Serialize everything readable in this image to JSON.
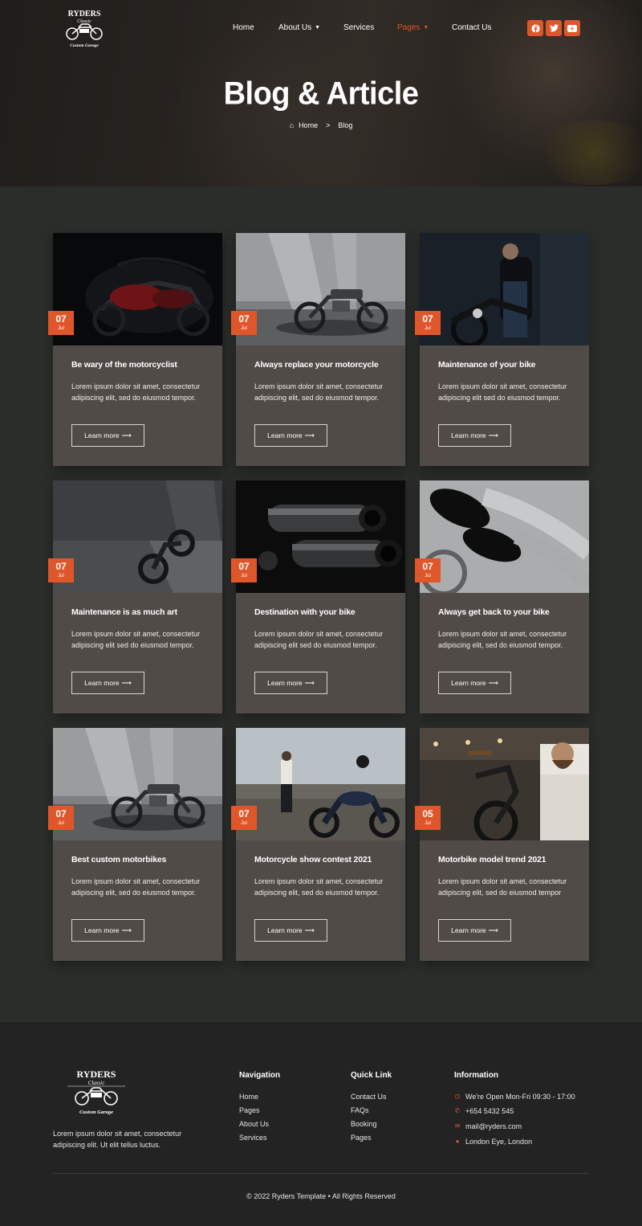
{
  "header": {
    "logo": {
      "brand": "RYDERS",
      "sub": "Classic",
      "tag": "Custom Garage"
    },
    "nav": [
      {
        "label": "Home",
        "caret": false,
        "active": false
      },
      {
        "label": "About Us",
        "caret": true,
        "active": false
      },
      {
        "label": "Services",
        "caret": false,
        "active": false
      },
      {
        "label": "Pages",
        "caret": true,
        "active": true
      },
      {
        "label": "Contact Us",
        "caret": false,
        "active": false
      }
    ],
    "social": [
      "facebook-icon",
      "twitter-icon",
      "youtube-icon"
    ]
  },
  "hero": {
    "title": "Blog & Article",
    "breadcrumb_home": "Home",
    "breadcrumb_sep": ">",
    "breadcrumb_current": "Blog"
  },
  "posts": [
    {
      "day": "07",
      "month": "Jul",
      "title": "Be wary of the motorcyclist",
      "text": "Lorem ipsum dolor sit amet, consectetur adipiscing elit, sed do eiusmod tempor.",
      "button": "Learn more",
      "scene": "red-bike-dark"
    },
    {
      "day": "07",
      "month": "Jul",
      "title": "Always replace your motorcycle",
      "text": "Lorem ipsum dolor sit amet, consectetur adipiscing elit, sed do eiusmod tempor.",
      "button": "Learn more",
      "scene": "cafe-racer-light"
    },
    {
      "day": "07",
      "month": "Jul",
      "title": "Maintenance of your bike",
      "text": "Lorem ipsum dolor sit amet, consectetur adipiscing elit sed do eiusmod tempor.",
      "button": "Learn more",
      "scene": "rider-leather"
    },
    {
      "day": "07",
      "month": "Jul",
      "title": "Maintenance is as much art",
      "text": "Lorem ipsum dolor sit amet, consectetur adipiscing elit sed do eiusmod tempor.",
      "button": "Learn more",
      "scene": "scrambler-garage"
    },
    {
      "day": "07",
      "month": "Jul",
      "title": "Destination with your bike",
      "text": "Lorem ipsum dolor sit amet, consectetur adipiscing elit sed do eiusmod tempor.",
      "button": "Learn more",
      "scene": "exhaust-dark"
    },
    {
      "day": "07",
      "month": "Jul",
      "title": "Always get back to your bike",
      "text": "Lorem ipsum dolor sit amet, consectetur adipiscing elit, sed do eiusmod tempor.",
      "button": "Learn more",
      "scene": "chrome-pipes"
    },
    {
      "day": "07",
      "month": "Jul",
      "title": "Best custom motorbikes",
      "text": "Lorem ipsum dolor sit amet, consectetur adipiscing elit, sed do eiusmod tempor.",
      "button": "Learn more",
      "scene": "cafe-racer-light"
    },
    {
      "day": "07",
      "month": "Jul",
      "title": "Motorcycle show contest 2021",
      "text": "Lorem ipsum dolor sit amet, consectetur adipiscing elit, sed do eiusmod tempor.",
      "button": "Learn more",
      "scene": "rider-outdoor"
    },
    {
      "day": "05",
      "month": "Jul",
      "title": "Motorbike model trend 2021",
      "text": "Lorem ipsum dolor sit amet, consectetur adipiscing elit, sed do eiusmod tempor",
      "button": "Learn more",
      "scene": "mechanic-workshop"
    }
  ],
  "footer": {
    "about": "Lorem ipsum dolor sit amet, consectetur adipiscing elit. Ut elit tellus luctus.",
    "navigation": {
      "heading": "Navigation",
      "links": [
        "Home",
        "Pages",
        "About Us",
        "Services"
      ]
    },
    "quick": {
      "heading": "Quick Link",
      "links": [
        "Contact Us",
        "FAQs",
        "Booking",
        "Pages"
      ]
    },
    "info": {
      "heading": "Information",
      "items": [
        {
          "icon": "clock-icon",
          "text": "We're Open Mon-Fri 09:30 - 17:00"
        },
        {
          "icon": "phone-icon",
          "text": "+654 5432 545"
        },
        {
          "icon": "mail-icon",
          "text": "mail@ryders.com"
        },
        {
          "icon": "location-icon",
          "text": "London Eye, London"
        }
      ]
    },
    "copyright": "© 2022 Ryders Template • All Rights Reserved"
  },
  "colors": {
    "accent": "#e0562b",
    "page_bg": "#2b2d2b",
    "card_bg": "#514b47",
    "footer_bg": "#222322"
  }
}
